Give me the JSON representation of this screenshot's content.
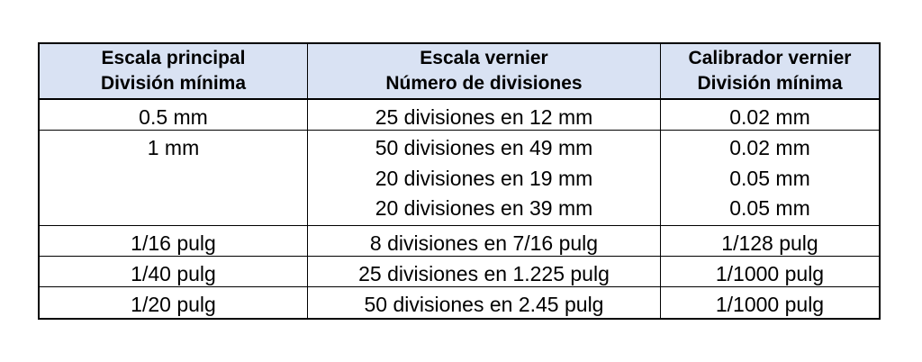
{
  "table": {
    "headers": [
      [
        "Escala principal",
        "División mínima"
      ],
      [
        "Escala vernier",
        "Número de divisiones"
      ],
      [
        "Calibrador vernier",
        "División mínima"
      ]
    ],
    "rows": [
      {
        "main": "0.5 mm",
        "vernier": [
          "25 divisiones en 12 mm"
        ],
        "caliper": [
          "0.02 mm"
        ]
      },
      {
        "main": "1 mm",
        "vernier": [
          "50 divisiones en 49 mm",
          "20 divisiones en 19 mm",
          "20 divisiones en 39 mm"
        ],
        "caliper": [
          "0.02 mm",
          "0.05 mm",
          "0.05 mm"
        ]
      },
      {
        "main": "1/16 pulg",
        "vernier": [
          "8 divisiones en 7/16 pulg"
        ],
        "caliper": [
          "1/128 pulg"
        ]
      },
      {
        "main": "1/40 pulg",
        "vernier": [
          "25 divisiones en 1.225 pulg"
        ],
        "caliper": [
          "1/1000 pulg"
        ]
      },
      {
        "main": "1/20 pulg",
        "vernier": [
          "50 divisiones en 2.45 pulg"
        ],
        "caliper": [
          "1/1000 pulg"
        ]
      }
    ]
  },
  "colors": {
    "header_bg": "#d9e2f3",
    "border": "#000000"
  }
}
